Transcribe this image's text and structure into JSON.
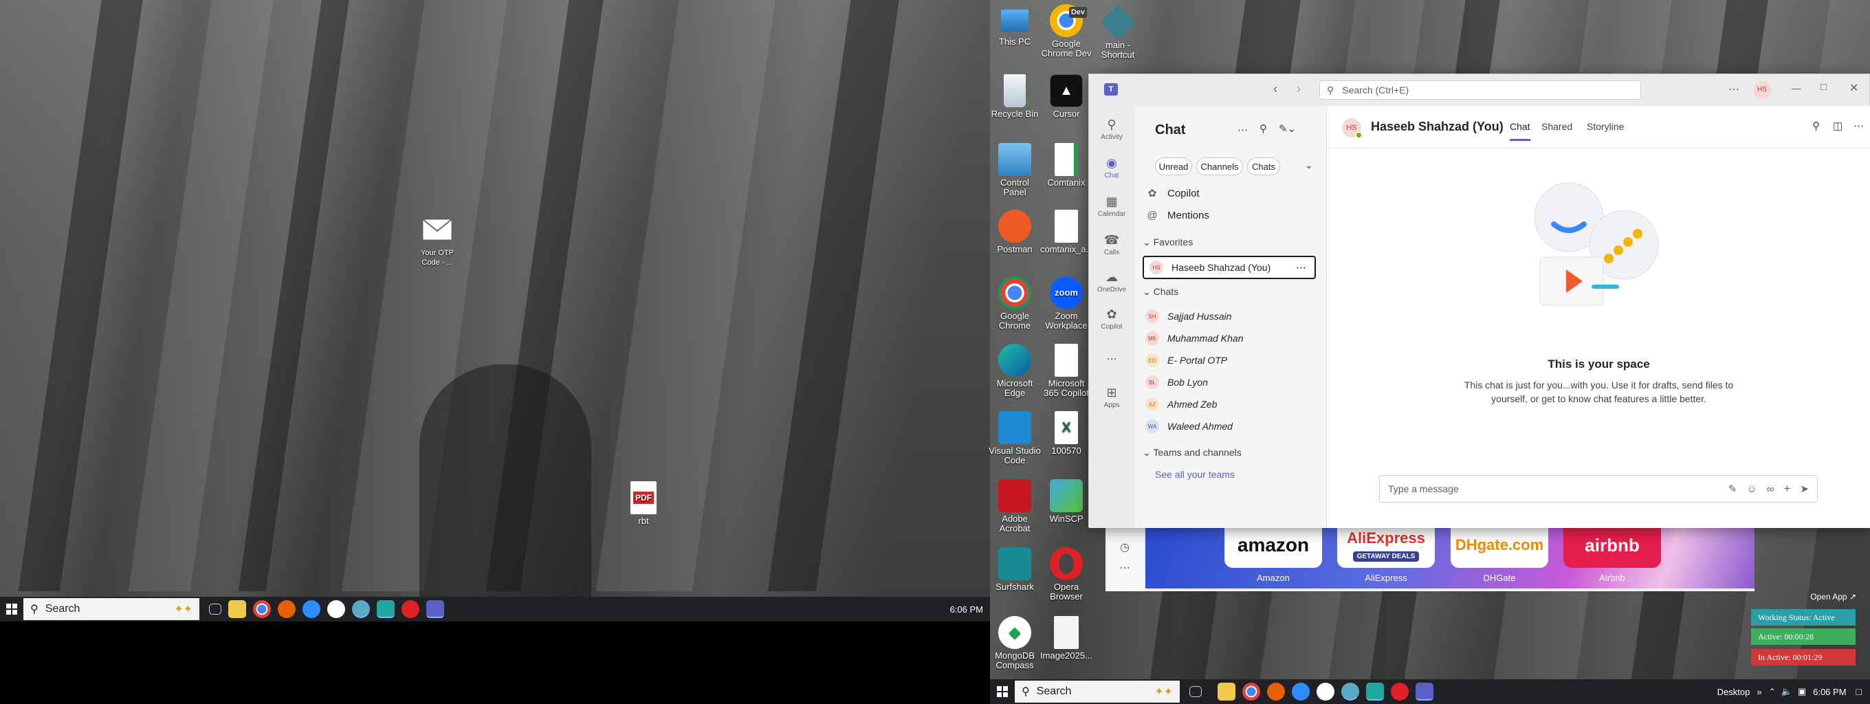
{
  "left_screen": {
    "desktop_icons": [
      {
        "label": "Your OTP Code - ...",
        "icon": "mail-icon"
      },
      {
        "label": "rbt",
        "icon": "pdf-file-icon",
        "badge": "PDF"
      }
    ],
    "taskbar": {
      "search_label": "Search",
      "time": "6:06 PM"
    }
  },
  "right_screen": {
    "desktop_icons": [
      {
        "label": "This PC",
        "icon": "computer-icon"
      },
      {
        "label": "Google Chrome Dev",
        "icon": "chrome-dev-icon",
        "badge": "Dev"
      },
      {
        "label": "main - Shortcut",
        "icon": "shortcut-icon"
      },
      {
        "label": "Recycle Bin",
        "icon": "recycle-bin-icon"
      },
      {
        "label": "Cursor",
        "icon": "cursor-app-icon"
      },
      {
        "label": "Control Panel",
        "icon": "control-panel-icon"
      },
      {
        "label": "Comtanix",
        "icon": "file-icon"
      },
      {
        "label": "Postman",
        "icon": "postman-icon"
      },
      {
        "label": "comtanix_a...",
        "icon": "file-icon"
      },
      {
        "label": "Google Chrome",
        "icon": "chrome-icon"
      },
      {
        "label": "Zoom Workplace",
        "icon": "zoom-icon",
        "badge": "zoom"
      },
      {
        "label": "Microsoft Edge",
        "icon": "edge-icon"
      },
      {
        "label": "Microsoft 365 Copilot",
        "icon": "file-icon"
      },
      {
        "label": "Visual Studio Code",
        "icon": "vscode-icon"
      },
      {
        "label": "100570",
        "icon": "excel-icon"
      },
      {
        "label": "Adobe Acrobat",
        "icon": "acrobat-icon"
      },
      {
        "label": "WinSCP",
        "icon": "winscp-icon"
      },
      {
        "label": "Surfshark",
        "icon": "surfshark-icon"
      },
      {
        "label": "Opera Browser",
        "icon": "opera-icon"
      },
      {
        "label": "MongoDB Compass",
        "icon": "mongodb-icon"
      },
      {
        "label": "Image2025...",
        "icon": "image-file-icon"
      }
    ],
    "taskbar": {
      "search_label": "Search",
      "desktop_label": "Desktop",
      "time": "6:06 PM"
    },
    "open_app_label": "Open App",
    "status": {
      "working": "Working Status: Active",
      "active": "Active: 00:00:28",
      "inactive": "In Active: 00:01:29"
    },
    "browser_tiles": [
      {
        "logo": "amazon",
        "label": "Amazon"
      },
      {
        "logo": "AliExpress",
        "sub": "GETAWAY DEALS",
        "label": "AliExpress"
      },
      {
        "logo": "DHgate.com",
        "label": "DHGate"
      },
      {
        "logo": "airbnb",
        "label": "Airbnb"
      }
    ]
  },
  "teams": {
    "search_placeholder": "Search (Ctrl+E)",
    "user_initials": "HS",
    "rail": [
      {
        "label": "Activity",
        "icon": "bell-icon"
      },
      {
        "label": "Chat",
        "icon": "chat-icon"
      },
      {
        "label": "Calendar",
        "icon": "calendar-icon"
      },
      {
        "label": "Calls",
        "icon": "phone-icon"
      },
      {
        "label": "OneDrive",
        "icon": "cloud-icon"
      },
      {
        "label": "Copilot",
        "icon": "copilot-icon"
      },
      {
        "label": "...",
        "icon": "more-icon"
      },
      {
        "label": "Apps",
        "icon": "apps-icon"
      }
    ],
    "chat_list": {
      "title": "Chat",
      "filters": [
        "Unread",
        "Channels",
        "Chats"
      ],
      "copilot": "Copilot",
      "mentions": "Mentions",
      "favorites_header": "Favorites",
      "favorite": {
        "initials": "HS",
        "name": "Haseeb Shahzad (You)"
      },
      "chats_header": "Chats",
      "chats": [
        {
          "initials": "SH",
          "name": "Sajjad Hussain"
        },
        {
          "initials": "MK",
          "name": "Muhammad Khan"
        },
        {
          "initials": "EO",
          "name": "E- Portal OTP"
        },
        {
          "initials": "BL",
          "name": "Bob Lyon"
        },
        {
          "initials": "AZ",
          "name": "Ahmed Zeb"
        },
        {
          "initials": "WA",
          "name": "Waleed Ahmed"
        }
      ],
      "teams_header": "Teams and channels",
      "see_all": "See all your teams"
    },
    "conversation": {
      "initials": "HS",
      "name": "Haseeb Shahzad (You)",
      "tabs": [
        "Chat",
        "Shared",
        "Storyline"
      ],
      "space_title": "This is your space",
      "space_desc_1": "This chat is just for you...with you. Use it for drafts, send files to",
      "space_desc_2": "yourself, or get to know chat features a little better.",
      "compose_placeholder": "Type a message"
    }
  }
}
